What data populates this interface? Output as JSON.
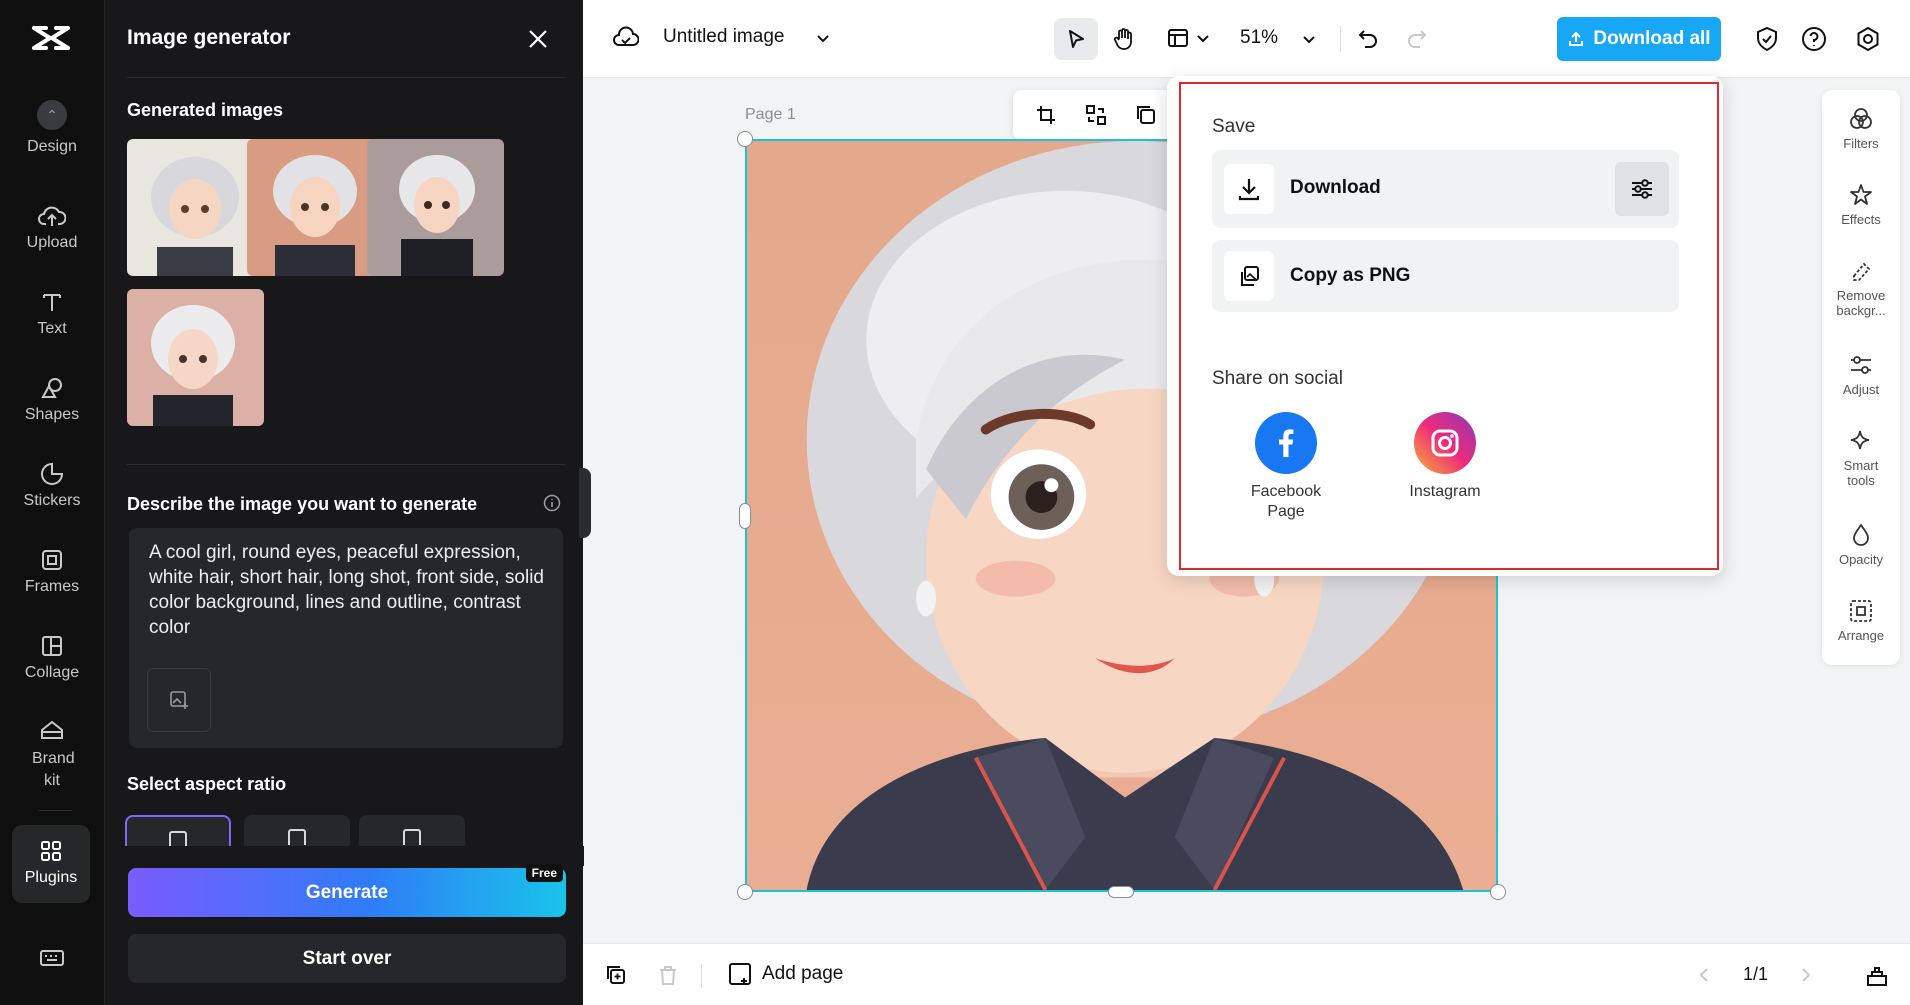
{
  "rail": {
    "items": [
      {
        "label": "Design"
      },
      {
        "label": "Upload"
      },
      {
        "label": "Text"
      },
      {
        "label": "Shapes"
      },
      {
        "label": "Stickers"
      },
      {
        "label": "Frames"
      },
      {
        "label": "Collage"
      },
      {
        "label": "Brand kit"
      },
      {
        "label": "Plugins"
      }
    ]
  },
  "panel": {
    "title": "Image generator",
    "generated_heading": "Generated images",
    "describe_heading": "Describe the image you want to generate",
    "prompt": "A cool girl, round eyes, peaceful expression, white hair, short hair, long shot, front side, solid color background, lines and outline, contrast color",
    "aspect_heading": "Select aspect ratio",
    "generate_label": "Generate",
    "free_badge": "Free",
    "start_over_label": "Start over"
  },
  "topbar": {
    "doc_title": "Untitled image",
    "zoom": "51%",
    "download_all": "Download all"
  },
  "canvas": {
    "page_label": "Page 1"
  },
  "right_rail": {
    "items": [
      {
        "label": "Filters"
      },
      {
        "label": "Effects"
      },
      {
        "label": "Remove backgr..."
      },
      {
        "label": "Adjust"
      },
      {
        "label": "Smart tools"
      },
      {
        "label": "Opacity"
      },
      {
        "label": "Arrange"
      }
    ]
  },
  "bottombar": {
    "add_page": "Add page",
    "page_count": "1/1"
  },
  "popover": {
    "save_heading": "Save",
    "download_label": "Download",
    "copy_png_label": "Copy as PNG",
    "share_heading": "Share on social",
    "facebook_label": "Facebook Page",
    "instagram_label": "Instagram"
  },
  "colors": {
    "accent": "#17a7f5",
    "selection": "#1cc3d6",
    "highlight_outline": "#e0282e",
    "facebook": "#1877f2"
  }
}
